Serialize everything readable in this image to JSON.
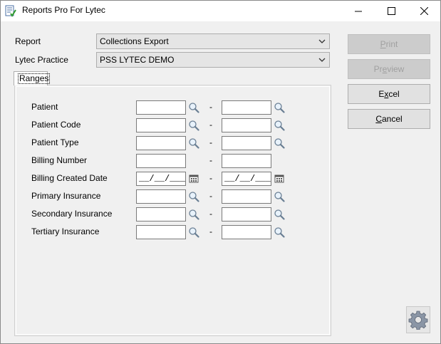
{
  "window": {
    "title": "Reports Pro For Lytec",
    "icons": {
      "app": "report-check-icon",
      "minimize": "minimize-icon",
      "maximize": "maximize-icon",
      "close": "close-icon"
    }
  },
  "form": {
    "report_label": "Report",
    "report_value": "Collections Export",
    "practice_label": "Lytec Practice",
    "practice_value": "PSS LYTEC DEMO"
  },
  "ranges_tab": "Ranges",
  "range_rows": [
    {
      "label": "Patient",
      "from": "",
      "to": "",
      "icon": "search-icon"
    },
    {
      "label": "Patient Code",
      "from": "",
      "to": "",
      "icon": "search-icon"
    },
    {
      "label": "Patient Type",
      "from": "",
      "to": "",
      "icon": "search-icon"
    },
    {
      "label": "Billing Number",
      "from": "",
      "to": "",
      "icon": ""
    },
    {
      "label": "Billing Created Date",
      "from": "__/__/____",
      "to": "__/__/____",
      "icon": "calendar-icon"
    },
    {
      "label": "Primary Insurance",
      "from": "",
      "to": "",
      "icon": "search-icon"
    },
    {
      "label": "Secondary Insurance",
      "from": "",
      "to": "",
      "icon": "search-icon"
    },
    {
      "label": "Tertiary Insurance",
      "from": "",
      "to": "",
      "icon": "search-icon"
    }
  ],
  "separator": "-",
  "buttons": {
    "print": "Print",
    "preview": "Preview",
    "excel": "Excel",
    "cancel": "Cancel"
  },
  "settings_icon": "gear-icon",
  "colors": {
    "disabled_text": "#a0a0a0",
    "window_bg": "#f0f0f0",
    "panel_border": "#d0d0d0"
  }
}
